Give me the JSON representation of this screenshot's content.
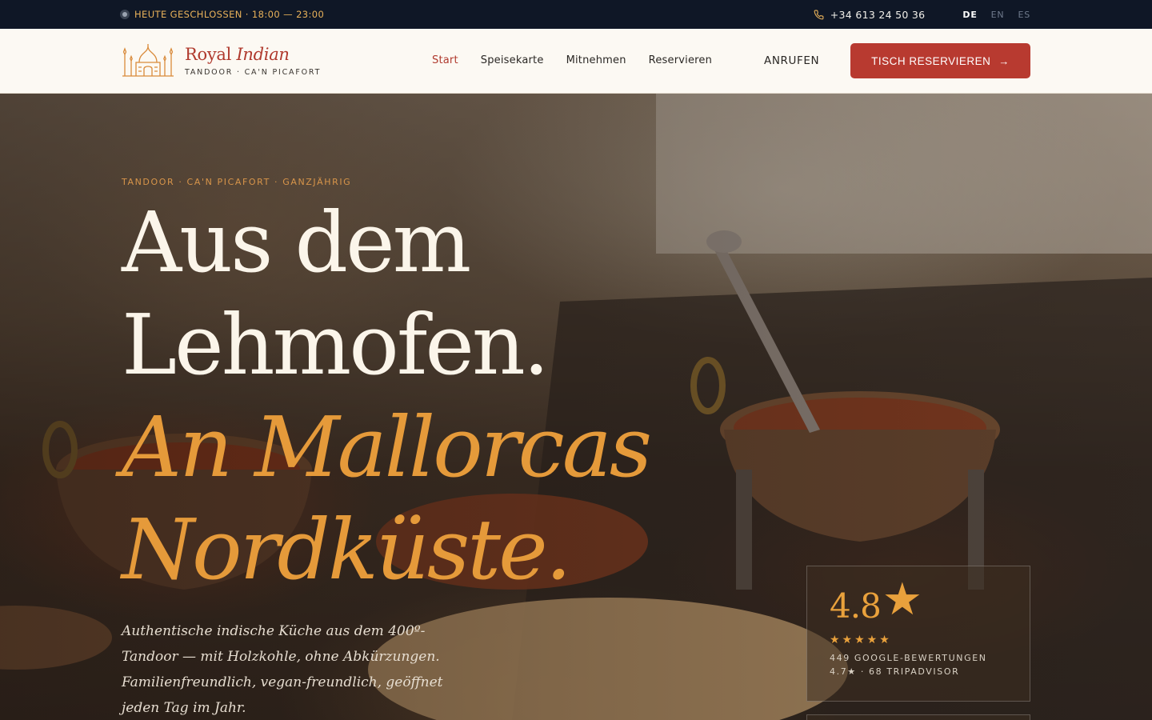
{
  "topbar": {
    "status": "HEUTE GESCHLOSSEN · 18:00 — 23:00",
    "status_icon": "status-dot-icon",
    "phone": "+34 613 24 50 36",
    "phone_icon": "phone-icon",
    "languages": [
      "DE",
      "EN",
      "ES"
    ],
    "active_language": "DE"
  },
  "header": {
    "logo": {
      "name_plain": "Royal ",
      "name_italic": "Indian",
      "subtitle": "TANDOOR · CA'N PICAFORT",
      "icon": "taj-mahal-icon"
    },
    "nav": [
      "Start",
      "Speisekarte",
      "Mitnehmen",
      "Reservieren"
    ],
    "active_nav": "Start",
    "call_label": "ANRUFEN",
    "cta_label": "TISCH RESERVIEREN",
    "cta_icon": "arrow-right-icon"
  },
  "hero": {
    "eyebrow": "TANDOOR · CA'N PICAFORT · GANZJÄHRIG",
    "headline_line1": "Aus dem",
    "headline_line2": "Lehmofen.",
    "headline_accent1": "An Mallorcas",
    "headline_accent2": "Nordküste.",
    "lead": "Authentische indische Küche aus dem 400º-Tandoor — mit Holzkohle, ohne Abkürzungen. Familienfreundlich, vegan-freundlich, geöffnet jeden Tag im Jahr."
  },
  "rating": {
    "score": "4.8",
    "big_star": "★",
    "stars": "★★★★★",
    "stars_value": 5,
    "google": "449 GOOGLE-BEWERTUNGEN",
    "tripadvisor": "4.7★ · 68 TRIPADVISOR"
  },
  "colors": {
    "topbar_bg": "#0f1726",
    "header_bg": "#fcf9f3",
    "brand_red": "#b83a30",
    "accent_gold": "#e59a3a"
  }
}
